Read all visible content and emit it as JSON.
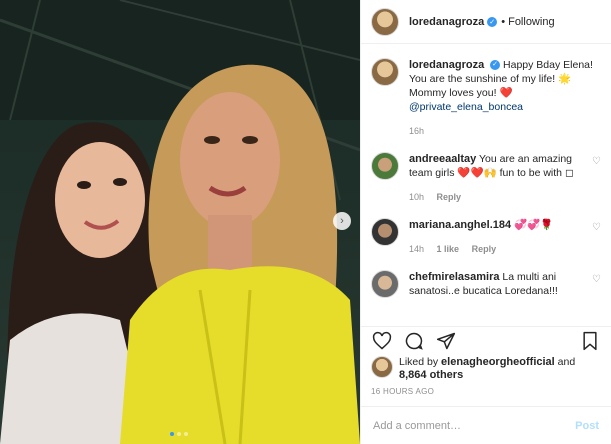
{
  "header": {
    "username": "loredanagroza",
    "follow_label": "• Following"
  },
  "caption": {
    "username": "loredanagroza",
    "text": "Happy Bday Elena! You are the sunshine of my life! 🌟 Mommy loves you! ❤️",
    "mention": "@private_elena_boncea",
    "time": "16h"
  },
  "comments": [
    {
      "username": "andreeaaltay",
      "text": "You are an amazing team girls ❤️❤️🙌 fun to be with ◻",
      "time": "10h",
      "reply": "Reply"
    },
    {
      "username": "mariana.anghel.184",
      "text": "💞💞🌹",
      "time": "14h",
      "likes": "1 like",
      "reply": "Reply"
    },
    {
      "username": "chefmirelasamira",
      "text": "La multi ani sanatosi..e bucatica Loredana!!!",
      "time": "",
      "reply": ""
    }
  ],
  "likes": {
    "prefix": "Liked by",
    "user": "elenagheorgheofficial",
    "middle": "and",
    "count": "8,864 others"
  },
  "timestamp": "16 HOURS AGO",
  "add_comment": {
    "placeholder": "Add a comment…",
    "post_label": "Post"
  },
  "colors": {
    "accent": "#3897f0",
    "text": "#262626",
    "muted": "#8e8e8e"
  }
}
